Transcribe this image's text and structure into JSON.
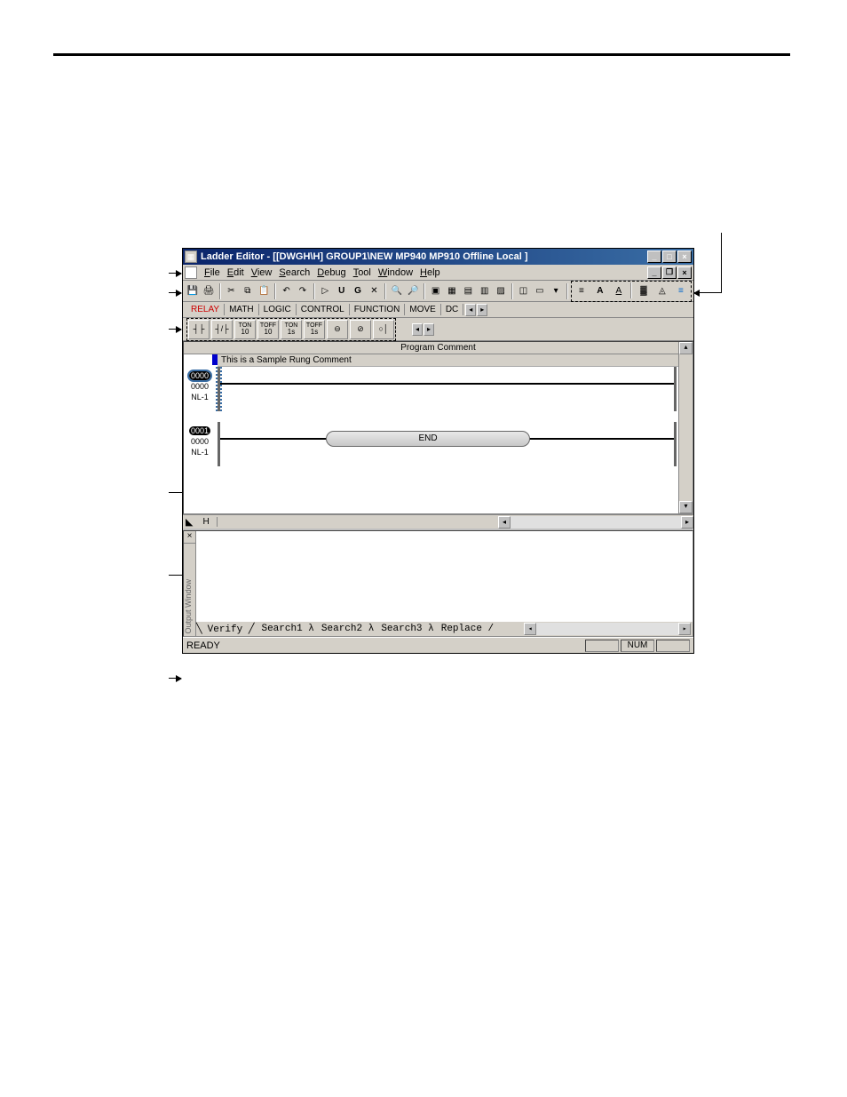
{
  "titlebar": {
    "text": "Ladder Editor - [[DWGH\\H]   GROUP1\\NEW  MP940  MP910    Offline  Local ]"
  },
  "menubar": {
    "items": [
      "File",
      "Edit",
      "View",
      "Search",
      "Debug",
      "Tool",
      "Window",
      "Help"
    ]
  },
  "instr_tabs": {
    "items": [
      "RELAY",
      "MATH",
      "LOGIC",
      "CONTROL",
      "FUNCTION",
      "MOVE",
      "DC"
    ],
    "active_index": 0
  },
  "instr_buttons": {
    "ton10": "TON 10",
    "toff10": "TOFF 10",
    "ton1s": "TON 1s",
    "toff1s": "TOFF 1s"
  },
  "program": {
    "header": "Program Comment",
    "rung_comment": "This is a Sample Rung Comment",
    "rungs": [
      {
        "num": "0000",
        "addr": "0000",
        "nl": "NL-1"
      },
      {
        "num": "0001",
        "addr": "0000",
        "nl": "NL-1",
        "end_label": "END"
      }
    ]
  },
  "sheet_tab": "H",
  "output": {
    "tabs_raw": "Verify  Search1  Search2  Search3  Replace",
    "tabs": [
      "Verify",
      "Search1",
      "Search2",
      "Search3",
      "Replace"
    ],
    "side_label": "Output Window"
  },
  "statusbar": {
    "text": "READY",
    "num": "NUM"
  }
}
